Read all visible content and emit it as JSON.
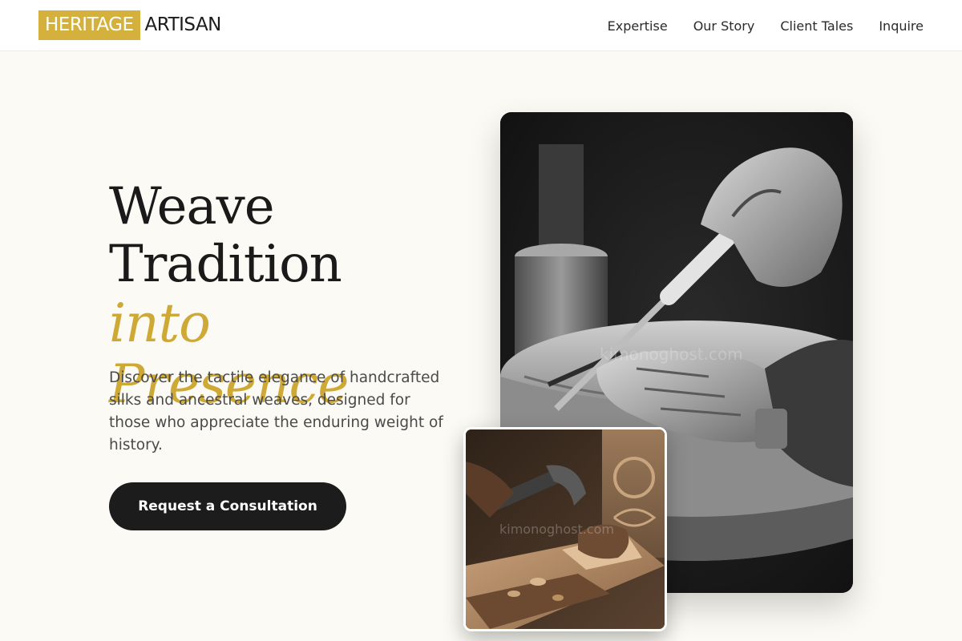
{
  "header": {
    "logo": {
      "mark": "HERITAGE",
      "word": "ARTISAN"
    },
    "nav": [
      "Expertise",
      "Our Story",
      "Client Tales",
      "Inquire"
    ]
  },
  "hero": {
    "title_line1": "Weave",
    "title_line2": "Tradition",
    "title_accent": "into Presence",
    "description": "Discover the tactile elegance of handcrafted silks and ancestral weaves, designed for those who appreciate the enduring weight of history.",
    "cta_label": "Request a Consultation"
  },
  "images": {
    "main_watermark": "kimonoghost.com",
    "small_watermark": "kimonoghost.com"
  },
  "colors": {
    "accent": "#d4b03d",
    "background": "#fbfaf4",
    "dark": "#1c1c1c"
  }
}
